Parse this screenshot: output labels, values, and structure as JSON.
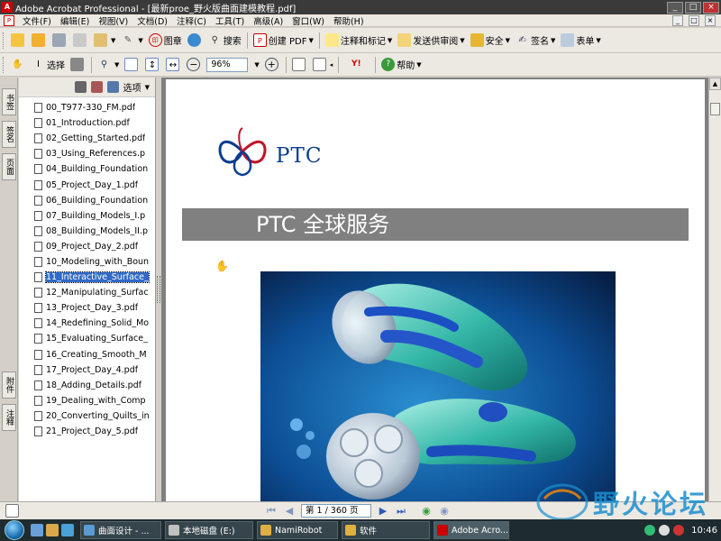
{
  "window": {
    "title": "Adobe Acrobat Professional - [最新proe_野火版曲面建模教程.pdf]",
    "controls": [
      "_",
      "□",
      "×"
    ]
  },
  "menu": {
    "items": [
      "文件(F)",
      "编辑(E)",
      "视图(V)",
      "文档(D)",
      "注释(C)",
      "工具(T)",
      "高级(A)",
      "窗口(W)",
      "帮助(H)"
    ]
  },
  "toolbar1": {
    "stamp": "图章",
    "search": "搜索",
    "create_pdf": "创建 PDF",
    "comment_markup": "注释和标记",
    "send_review": "发送供审阅",
    "secure": "安全",
    "sign": "签名",
    "forms": "表单"
  },
  "toolbar2": {
    "select": "选择",
    "zoom_value": "96%",
    "help": "帮助"
  },
  "left_tabs": [
    "书签",
    "签名",
    "页面",
    "附件",
    "注释"
  ],
  "nav_panel": {
    "options_label": "选项",
    "files": [
      "00_T977-330_FM.pdf",
      "01_Introduction.pdf",
      "02_Getting_Started.pdf",
      "03_Using_References.p",
      "04_Building_Foundation",
      "05_Project_Day_1.pdf",
      "06_Building_Foundation",
      "07_Building_Models_I.p",
      "08_Building_Models_II.p",
      "09_Project_Day_2.pdf",
      "10_Modeling_with_Boun",
      "11_Interactive_Surface_",
      "12_Manipulating_Surfac",
      "13_Project_Day_3.pdf",
      "14_Redefining_Solid_Mo",
      "15_Evaluating_Surface_",
      "16_Creating_Smooth_M",
      "17_Project_Day_4.pdf",
      "18_Adding_Details.pdf",
      "19_Dealing_with_Comp",
      "20_Converting_Quilts_in",
      "21_Project_Day_5.pdf"
    ],
    "selected_index": 11
  },
  "document": {
    "logo_text": "PTC",
    "banner_title": "PTC 全球服务"
  },
  "pagenav": {
    "page_display": "第 1 / 360 页"
  },
  "watermark": {
    "text": "野火论坛"
  },
  "taskbar": {
    "items": [
      "曲面设计 - ...",
      "本地磁盘 (E:)",
      "NamiRobot",
      "软件",
      "Adobe Acro..."
    ],
    "clock": "10:46"
  },
  "colors": {
    "title_bar": "#3a3a3a",
    "selection": "#316ac5",
    "banner": "#808080",
    "ptc_blue": "#0a3d91",
    "taskbar": "#1e2b2f"
  }
}
